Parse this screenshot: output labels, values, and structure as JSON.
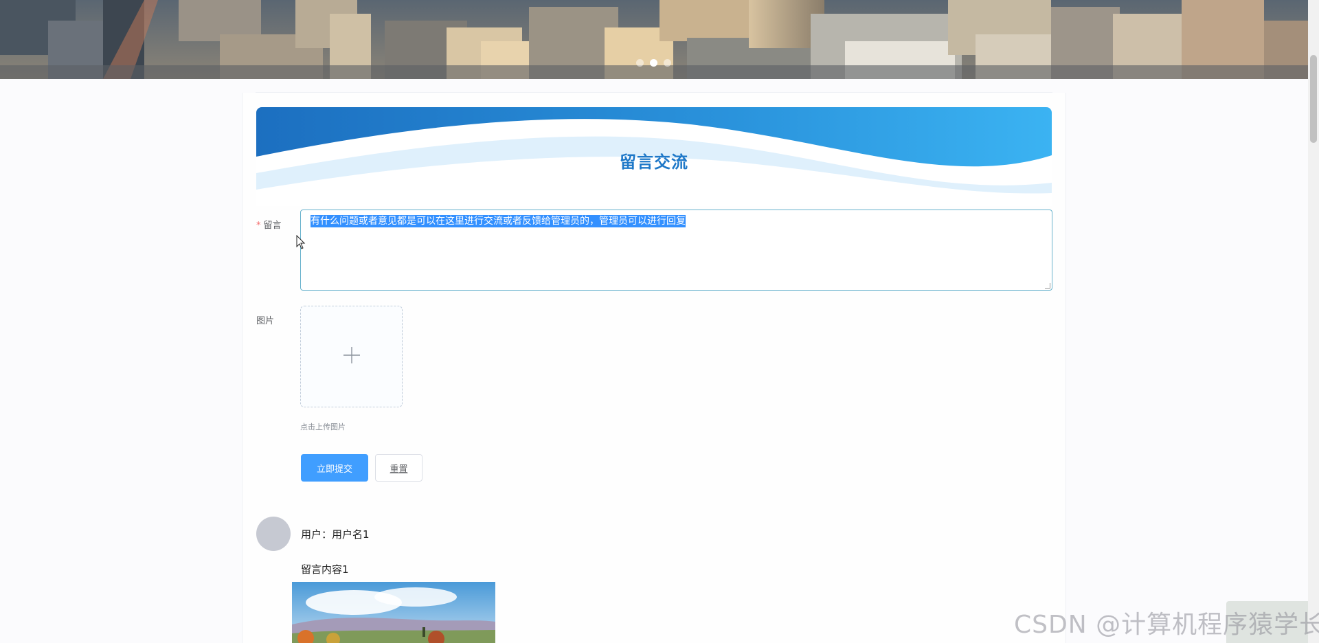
{
  "banner": {
    "active_slide": 2,
    "slide_count": 3
  },
  "header": {
    "title": "留言交流"
  },
  "form": {
    "message_label": "留言",
    "message_required": "*",
    "message_value": "有什么问题或者意见都是可以在这里进行交流或者反馈给管理员的，管理员可以进行回复",
    "image_label": "图片",
    "upload_tip": "点击上传图片",
    "submit_label": "立即提交",
    "reset_label": "重置"
  },
  "comments": [
    {
      "user": "用户：用户名1",
      "content": "留言内容1"
    }
  ],
  "watermark": "CSDN @计算机程序猿学长",
  "colors": {
    "primary": "#409eff",
    "title": "#1e78c8",
    "header_wave": "#2a8fd8",
    "selection": "#3390ff",
    "required": "#f56c6c"
  },
  "icons": {
    "upload": "plus-icon",
    "cursor": "mouse-pointer-icon"
  }
}
